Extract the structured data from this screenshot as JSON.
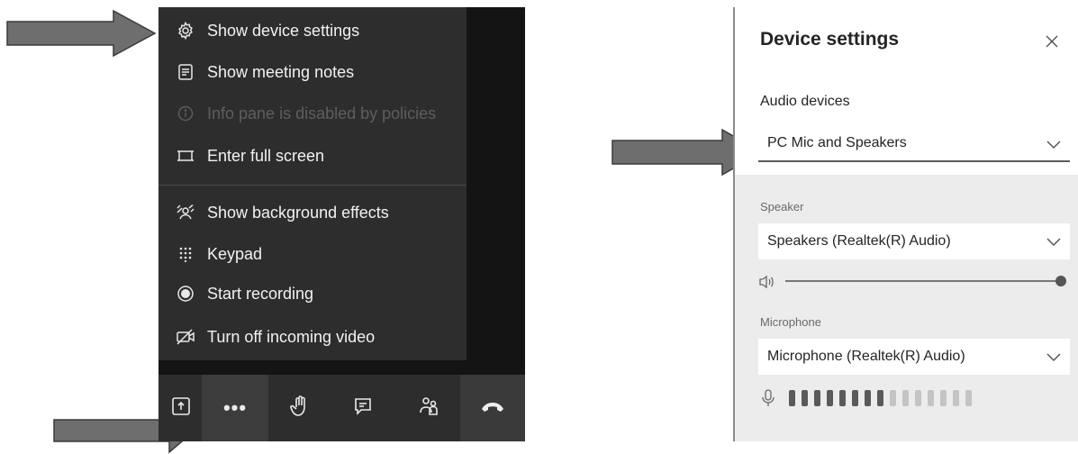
{
  "menu": {
    "items": [
      {
        "label": "Show device settings",
        "icon": "gear-icon",
        "enabled": true
      },
      {
        "label": "Show meeting notes",
        "icon": "notes-icon",
        "enabled": true
      },
      {
        "label": "Info pane is disabled by policies",
        "icon": "info-icon",
        "enabled": false
      },
      {
        "label": "Enter full screen",
        "icon": "fullscreen-icon",
        "enabled": true
      },
      {
        "label": "Show background effects",
        "icon": "background-effects-icon",
        "enabled": true
      },
      {
        "label": "Keypad",
        "icon": "keypad-icon",
        "enabled": true
      },
      {
        "label": "Start recording",
        "icon": "record-icon",
        "enabled": true
      },
      {
        "label": "Turn off incoming video",
        "icon": "video-off-icon",
        "enabled": true
      }
    ]
  },
  "toolbar": {
    "more_label": "•••",
    "buttons": [
      "share-screen-icon",
      "more-options-icon",
      "raise-hand-icon",
      "chat-icon",
      "participants-icon",
      "hang-up-icon"
    ]
  },
  "settings": {
    "title": "Device settings",
    "audio_devices_label": "Audio devices",
    "audio_device_value": "PC Mic and Speakers",
    "speaker_label": "Speaker",
    "speaker_value": "Speakers (Realtek(R) Audio)",
    "speaker_volume_fraction": 1.0,
    "microphone_label": "Microphone",
    "microphone_value": "Microphone (Realtek(R) Audio)",
    "mic_level_active_bars": 8,
    "mic_level_total_bars": 15
  },
  "colors": {
    "menu_background": "#2d2d2d",
    "toolbar_background": "#2d2d2d",
    "panel_background": "#ececec",
    "arrow_fill": "#6e6e6e"
  }
}
